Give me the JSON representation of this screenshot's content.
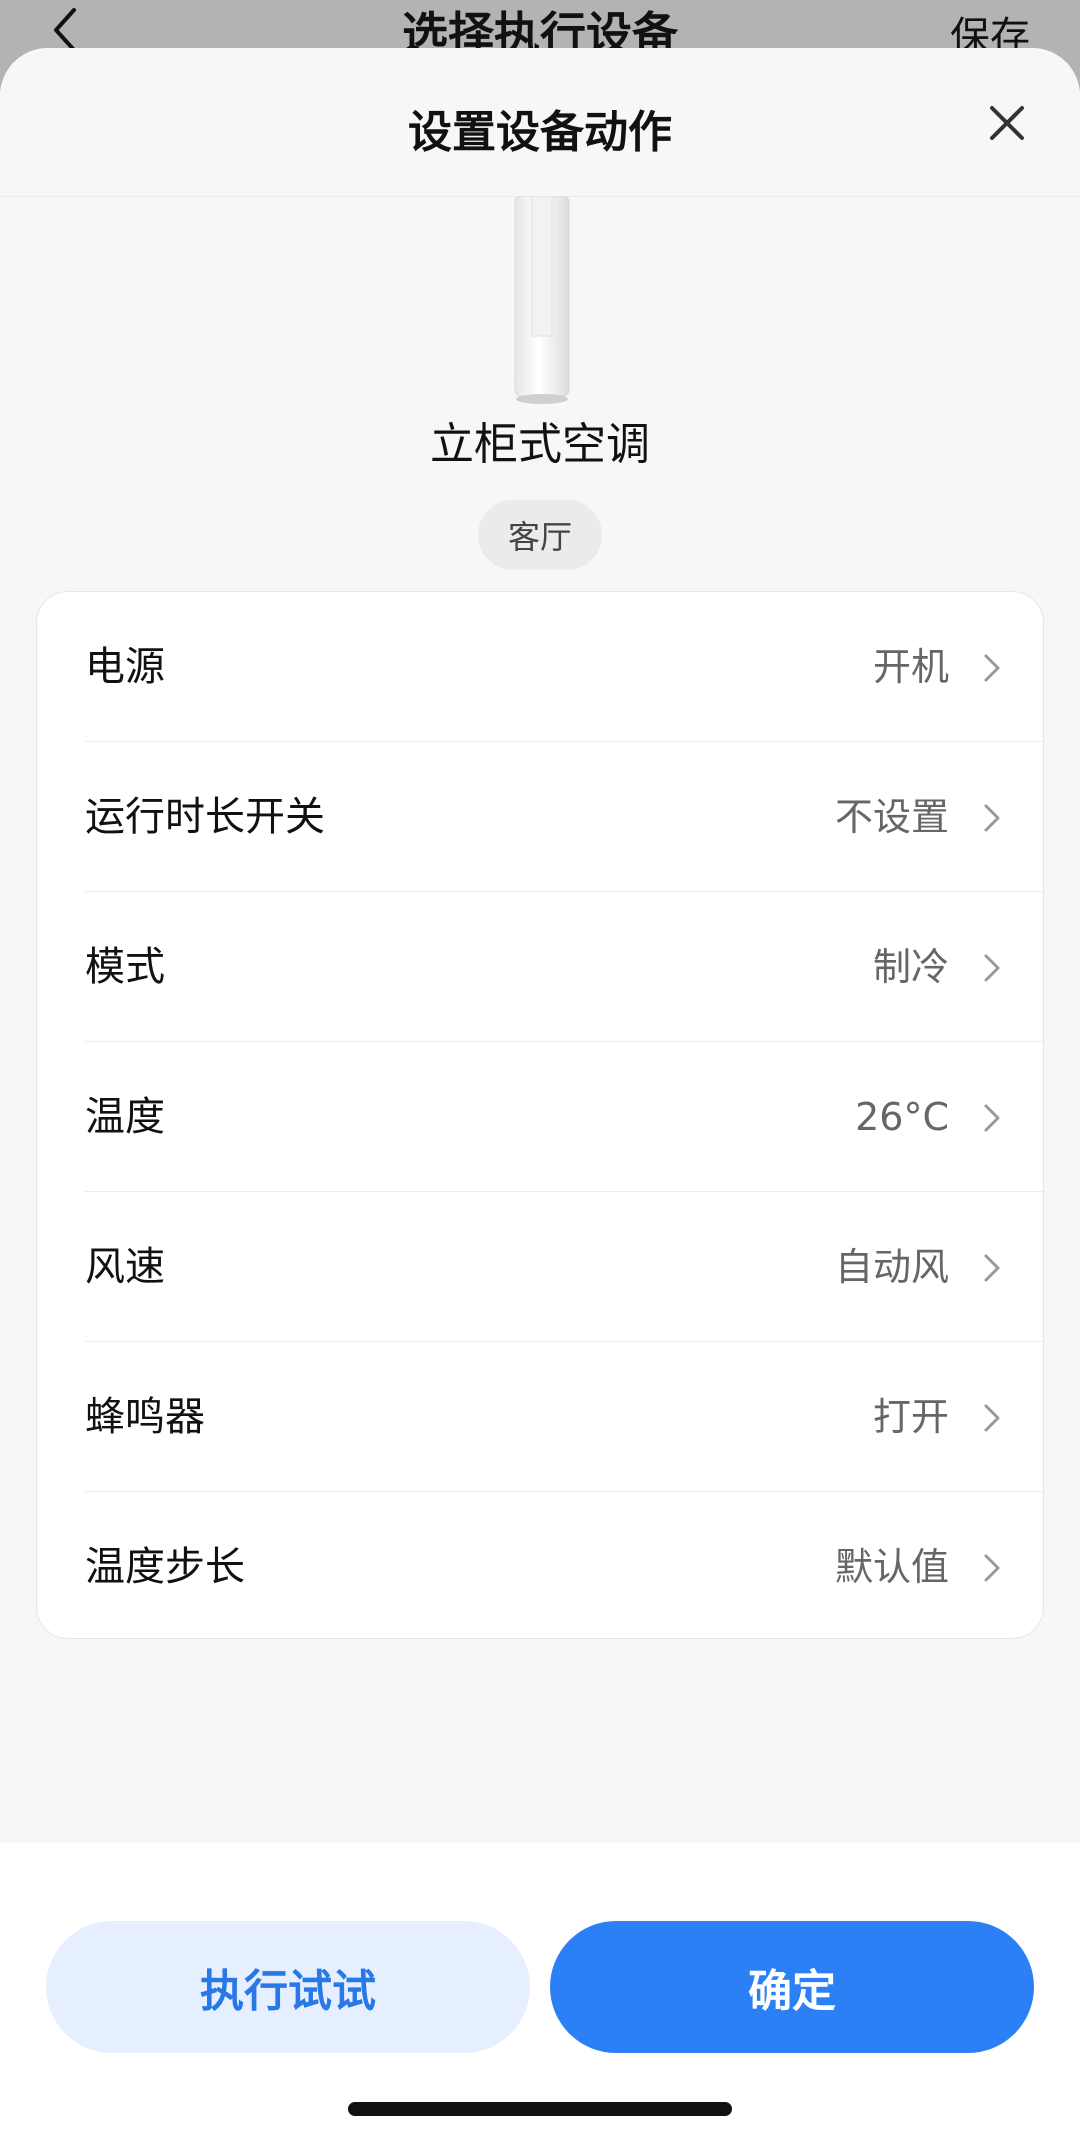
{
  "background_page": {
    "title": "选择执行设备",
    "save_label": "保存"
  },
  "sheet": {
    "title": "设置设备动作"
  },
  "device": {
    "name": "立柜式空调",
    "room": "客厅"
  },
  "settings": [
    {
      "label": "电源",
      "value": "开机"
    },
    {
      "label": "运行时长开关",
      "value": "不设置"
    },
    {
      "label": "模式",
      "value": "制冷"
    },
    {
      "label": "温度",
      "value": "26°C"
    },
    {
      "label": "风速",
      "value": "自动风"
    },
    {
      "label": "蜂鸣器",
      "value": "打开"
    },
    {
      "label": "温度步长",
      "value": "默认值"
    }
  ],
  "footer": {
    "try_label": "执行试试",
    "confirm_label": "确定"
  },
  "colors": {
    "primary": "#2b80f5",
    "secondary_bg": "#e6efff",
    "secondary_text": "#2878e8"
  }
}
